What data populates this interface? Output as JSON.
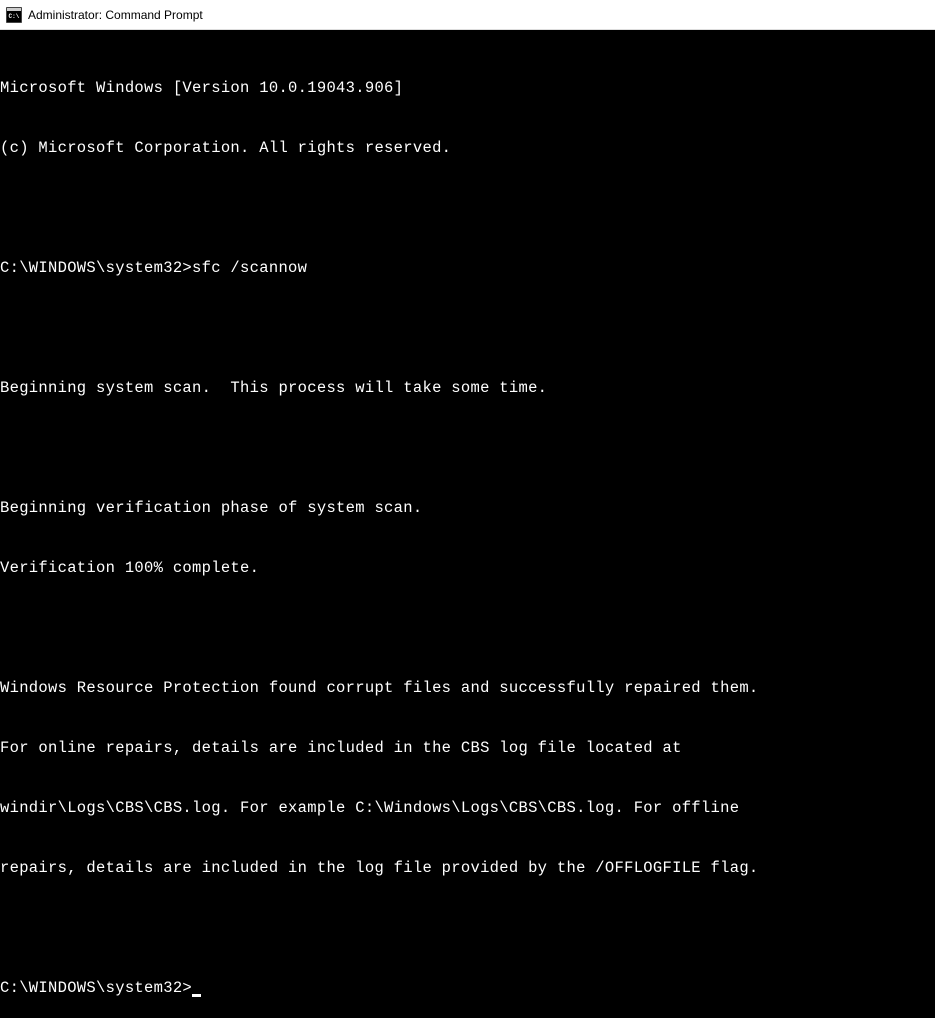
{
  "window": {
    "title": "Administrator: Command Prompt"
  },
  "terminal": {
    "lines": [
      "Microsoft Windows [Version 10.0.19043.906]",
      "(c) Microsoft Corporation. All rights reserved.",
      "",
      "C:\\WINDOWS\\system32>sfc /scannow",
      "",
      "Beginning system scan.  This process will take some time.",
      "",
      "Beginning verification phase of system scan.",
      "Verification 100% complete.",
      "",
      "Windows Resource Protection found corrupt files and successfully repaired them.",
      "For online repairs, details are included in the CBS log file located at",
      "windir\\Logs\\CBS\\CBS.log. For example C:\\Windows\\Logs\\CBS\\CBS.log. For offline",
      "repairs, details are included in the log file provided by the /OFFLOGFILE flag.",
      ""
    ],
    "prompt": "C:\\WINDOWS\\system32>"
  }
}
